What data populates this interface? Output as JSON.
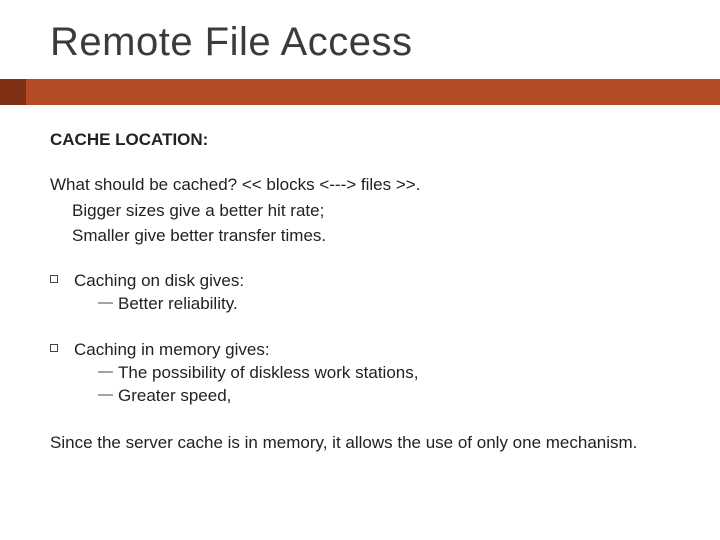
{
  "title": "Remote File Access",
  "section_heading": "CACHE LOCATION:",
  "intro": "What should be cached? << blocks <---> files >>.",
  "intro_sub1": "Bigger sizes give a better hit rate;",
  "intro_sub2": "Smaller give better transfer times.",
  "groups": [
    {
      "lead": "Caching on disk gives:",
      "items": [
        "Better reliability."
      ]
    },
    {
      "lead": "Caching in memory gives:",
      "items": [
        "The possibility of diskless work stations,",
        "Greater speed,"
      ]
    }
  ],
  "closing": "Since the server cache is in memory, it allows the use of only one mechanism."
}
